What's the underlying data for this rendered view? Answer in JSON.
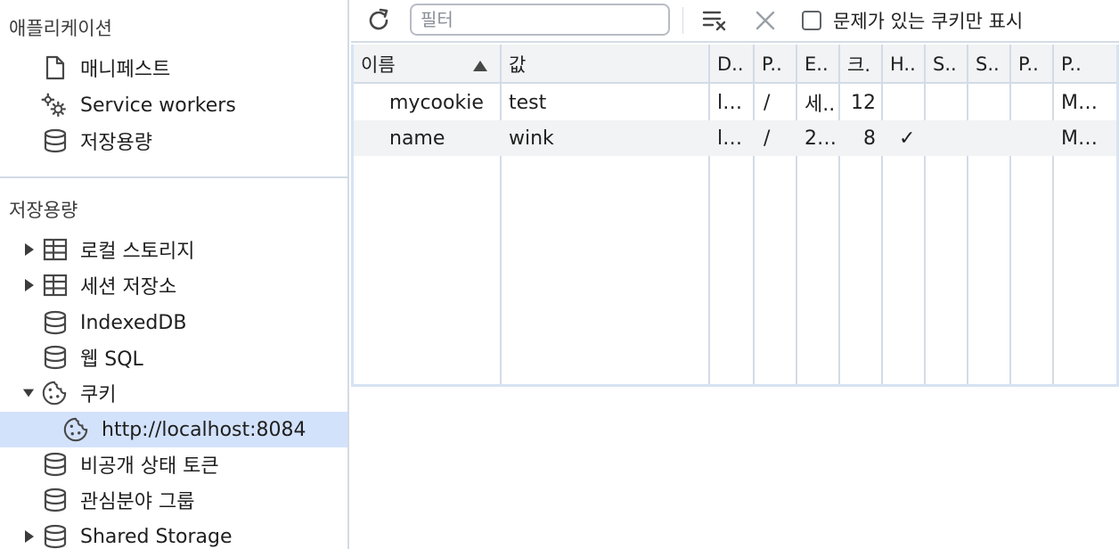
{
  "sidebar": {
    "app_section_title": "애플리케이션",
    "app_items": [
      {
        "label": "매니페스트",
        "icon": "file-icon"
      },
      {
        "label": "Service workers",
        "icon": "gears-icon"
      },
      {
        "label": "저장용량",
        "icon": "database-icon"
      }
    ],
    "storage_section_title": "저장용량",
    "storage_items": [
      {
        "label": "로컬 스토리지",
        "icon": "table-icon"
      },
      {
        "label": "세션 저장소",
        "icon": "table-icon"
      },
      {
        "label": "IndexedDB",
        "icon": "database-icon"
      },
      {
        "label": "웹 SQL",
        "icon": "database-icon"
      },
      {
        "label": "쿠키",
        "icon": "cookie-icon"
      },
      {
        "label": "http://localhost:8084",
        "icon": "cookie-icon"
      },
      {
        "label": "비공개 상태 토큰",
        "icon": "database-icon"
      },
      {
        "label": "관심분야 그룹",
        "icon": "database-icon"
      },
      {
        "label": "Shared Storage",
        "icon": "database-icon"
      }
    ]
  },
  "toolbar": {
    "filter_placeholder": "필터",
    "filter_value": "",
    "only_issues_label": "문제가 있는 쿠키만 표시",
    "only_issues_checked": false
  },
  "table": {
    "headers": [
      "이름",
      "값",
      "D..",
      "P..",
      "E..",
      "크.",
      "H..",
      "S..",
      "S..",
      "P..",
      "P.."
    ],
    "sorted_column": "이름",
    "sort_direction": "ascending",
    "rows": [
      [
        "mycookie",
        "test",
        "l…",
        "/",
        "세..",
        "12",
        "",
        "",
        "",
        "",
        "M…"
      ],
      [
        "name",
        "wink",
        "l…",
        "/",
        "2…",
        "8",
        "✓",
        "",
        "",
        "",
        "M…"
      ]
    ]
  },
  "colors": {
    "selection": "#d3e2fb",
    "border": "#d3dbe6",
    "header_bg": "#f1f3f4",
    "text": "#1f1f1f"
  }
}
